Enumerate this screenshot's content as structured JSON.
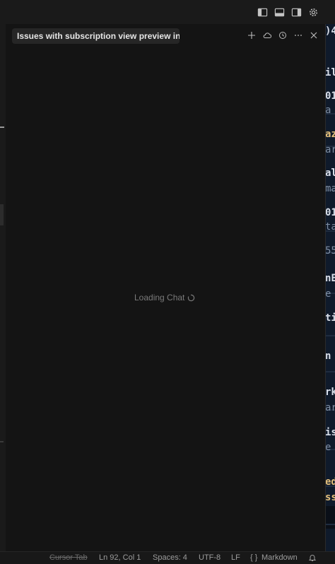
{
  "chat": {
    "tab_title": "Issues with subscription view preview in Xc",
    "loading_text": "Loading Chat"
  },
  "icons": {
    "layout": [
      "toggle-primary-sidebar-icon",
      "toggle-panel-icon",
      "toggle-secondary-sidebar-icon",
      "settings-gear-icon"
    ],
    "tab_actions": [
      "plus-icon",
      "cloud-icon",
      "history-icon",
      "more-icon",
      "close-icon"
    ]
  },
  "editor_peek": {
    "lines": [
      {
        "text": ")4",
        "style": "w"
      },
      {
        "text": "il",
        "style": "w"
      },
      {
        "text": "01",
        "style": "w"
      },
      {
        "text": "a",
        "style": "d"
      },
      {
        "text": "az",
        "style": "y"
      },
      {
        "text": "ar",
        "style": "d"
      },
      {
        "text": "al",
        "style": "w"
      },
      {
        "text": "ma",
        "style": "d"
      },
      {
        "text": "01",
        "style": "w"
      },
      {
        "text": "ta",
        "style": "d"
      },
      {
        "text": "55",
        "style": "d"
      },
      {
        "text": "nE",
        "style": "w"
      },
      {
        "text": "e",
        "style": "d"
      },
      {
        "text": "ti",
        "style": "w"
      },
      {
        "text": "n",
        "style": "w"
      },
      {
        "text": "rk",
        "style": "w"
      },
      {
        "text": "ar",
        "style": "d"
      },
      {
        "text": "is",
        "style": "w"
      },
      {
        "text": "e",
        "style": "d"
      },
      {
        "text": "ed",
        "style": "y"
      },
      {
        "text": "ss",
        "style": "y"
      }
    ]
  },
  "statusbar": {
    "cursor_tab": "Cursor Tab",
    "position": "Ln 92, Col 1",
    "spaces": "Spaces: 4",
    "encoding": "UTF-8",
    "eol": "LF",
    "language_icon": "{ }",
    "language": "Markdown"
  }
}
